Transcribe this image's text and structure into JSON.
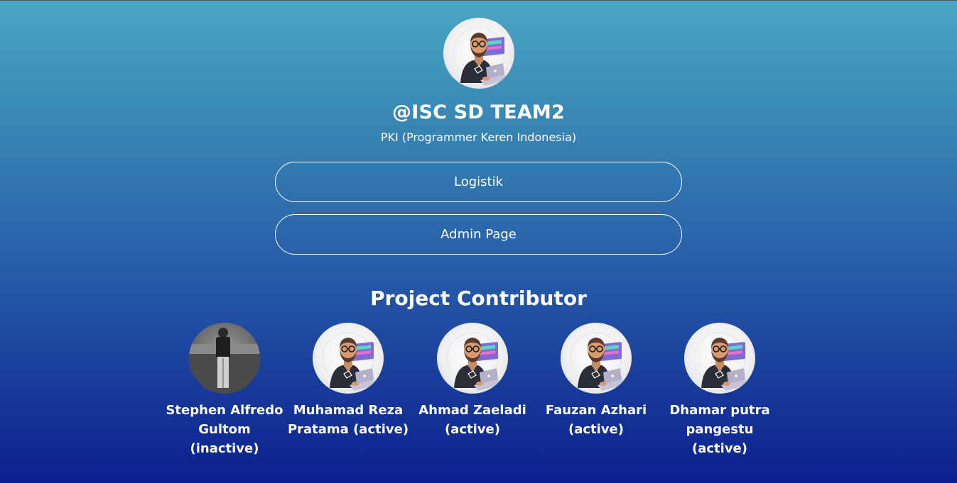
{
  "profile": {
    "handle": "@ISC SD TEAM2",
    "tagline": "PKI (Programmer Keren Indonesia)",
    "avatar_icon": "developer-avatar-icon"
  },
  "links": [
    {
      "label": "Logistik"
    },
    {
      "label": "Admin Page"
    }
  ],
  "contributors_section": {
    "title": "Project Contributor",
    "items": [
      {
        "name": "Stephen Alfredo Gultom (inactive)",
        "avatar": "photo-avatar"
      },
      {
        "name": "Muhamad Reza Pratama (active)",
        "avatar": "developer-avatar-icon"
      },
      {
        "name": "Ahmad Zaeladi (active)",
        "avatar": "developer-avatar-icon"
      },
      {
        "name": "Fauzan Azhari (active)",
        "avatar": "developer-avatar-icon"
      },
      {
        "name": "Dhamar putra pangestu (active)",
        "avatar": "developer-avatar-icon"
      }
    ]
  },
  "colors": {
    "gradient_top": "#4aa6c2",
    "gradient_bottom": "#0b1f8f",
    "text": "#ffffff"
  }
}
